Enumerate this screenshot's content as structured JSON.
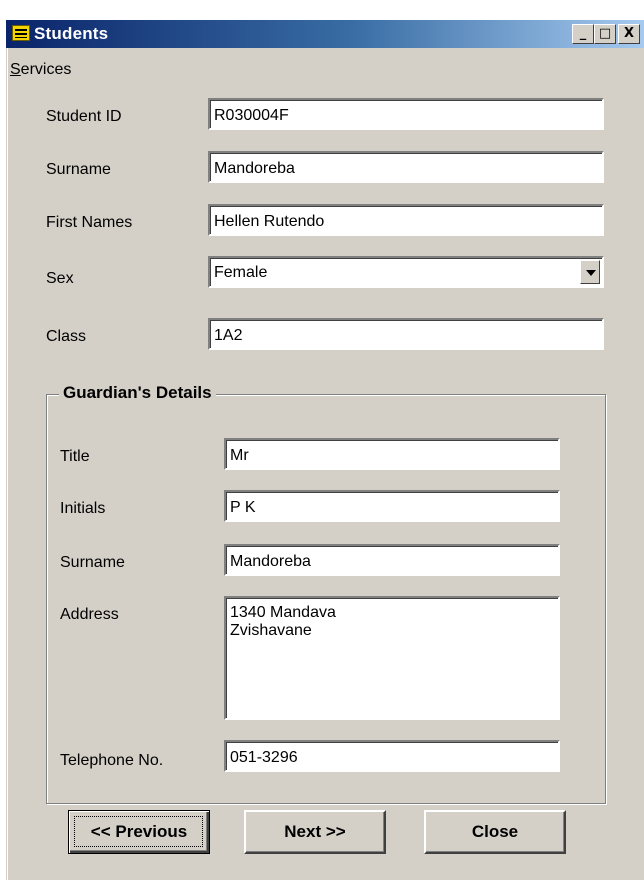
{
  "window": {
    "title": "Students",
    "controls": {
      "minimize": "_",
      "maximize": "□",
      "close": "X"
    }
  },
  "menu": {
    "services_mnemonic": "S",
    "services_rest": "ervices"
  },
  "form": {
    "student_id": {
      "label": "Student ID",
      "value": "R030004F"
    },
    "surname": {
      "label": "Surname",
      "value": "Mandoreba"
    },
    "first_names": {
      "label": "First Names",
      "value": "Hellen Rutendo"
    },
    "sex": {
      "label": "Sex",
      "value": "Female"
    },
    "class": {
      "label": "Class",
      "value": "1A2"
    }
  },
  "guardian": {
    "title": "Guardian's Details",
    "title_field": {
      "label": "Title",
      "value": "Mr"
    },
    "initials": {
      "label": "Initials",
      "value": "P K"
    },
    "surname": {
      "label": "Surname",
      "value": "Mandoreba"
    },
    "address": {
      "label": "Address",
      "value": "1340 Mandava\nZvishavane"
    },
    "telephone": {
      "label": "Telephone No.",
      "value": "051-3296"
    }
  },
  "buttons": {
    "previous": "<< Previous",
    "next": "Next >>",
    "close": "Close"
  },
  "colors": {
    "face": "#d4d0c8",
    "title_start": "#0a246a",
    "title_end": "#a6caf0"
  }
}
